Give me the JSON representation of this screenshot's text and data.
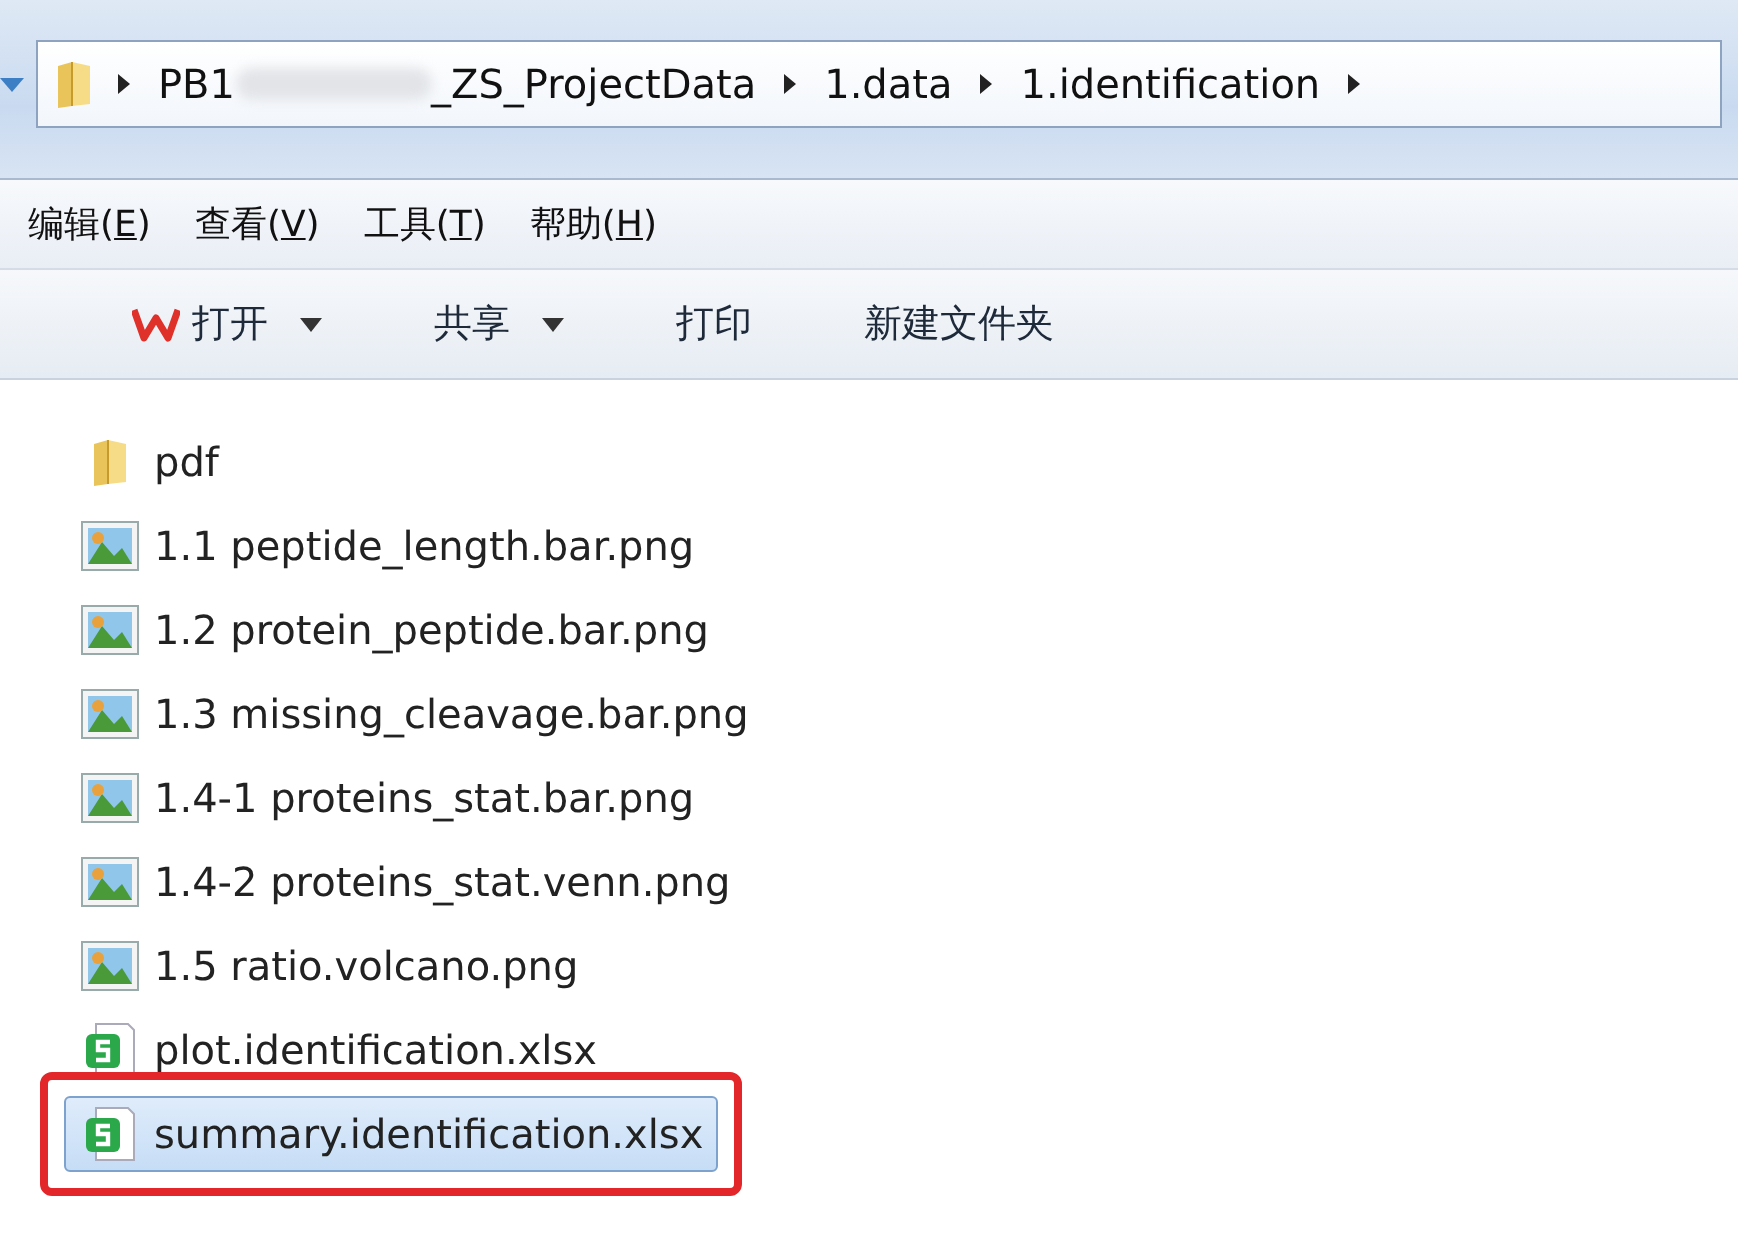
{
  "address_bar": {
    "crumbs": [
      {
        "label_start": "PB1",
        "label_end": "_ZS_ProjectData",
        "redacted": true
      },
      {
        "label_start": "1.data",
        "redacted": false
      },
      {
        "label_start": "1.identification",
        "redacted": false
      }
    ]
  },
  "menu": [
    {
      "label": "编辑(E)"
    },
    {
      "label": "查看(V)"
    },
    {
      "label": "工具(T)"
    },
    {
      "label": "帮助(H)"
    }
  ],
  "toolbar": [
    {
      "label": "打开",
      "kind": "app",
      "dropdown": true
    },
    {
      "label": "共享",
      "kind": "plain",
      "dropdown": true
    },
    {
      "label": "打印",
      "kind": "plain",
      "dropdown": false
    },
    {
      "label": "新建文件夹",
      "kind": "plain",
      "dropdown": false
    }
  ],
  "files": [
    {
      "name": "pdf",
      "kind": "folder",
      "selected": false
    },
    {
      "name": "1.1 peptide_length.bar.png",
      "kind": "image",
      "selected": false
    },
    {
      "name": "1.2 protein_peptide.bar.png",
      "kind": "image",
      "selected": false
    },
    {
      "name": "1.3 missing_cleavage.bar.png",
      "kind": "image",
      "selected": false
    },
    {
      "name": "1.4-1 proteins_stat.bar.png",
      "kind": "image",
      "selected": false
    },
    {
      "name": "1.4-2 proteins_stat.venn.png",
      "kind": "image",
      "selected": false
    },
    {
      "name": "1.5 ratio.volcano.png",
      "kind": "image",
      "selected": false
    },
    {
      "name": "plot.identification.xlsx",
      "kind": "spreadsheet",
      "selected": false
    },
    {
      "name": "summary.identification.xlsx",
      "kind": "spreadsheet",
      "selected": true
    }
  ]
}
